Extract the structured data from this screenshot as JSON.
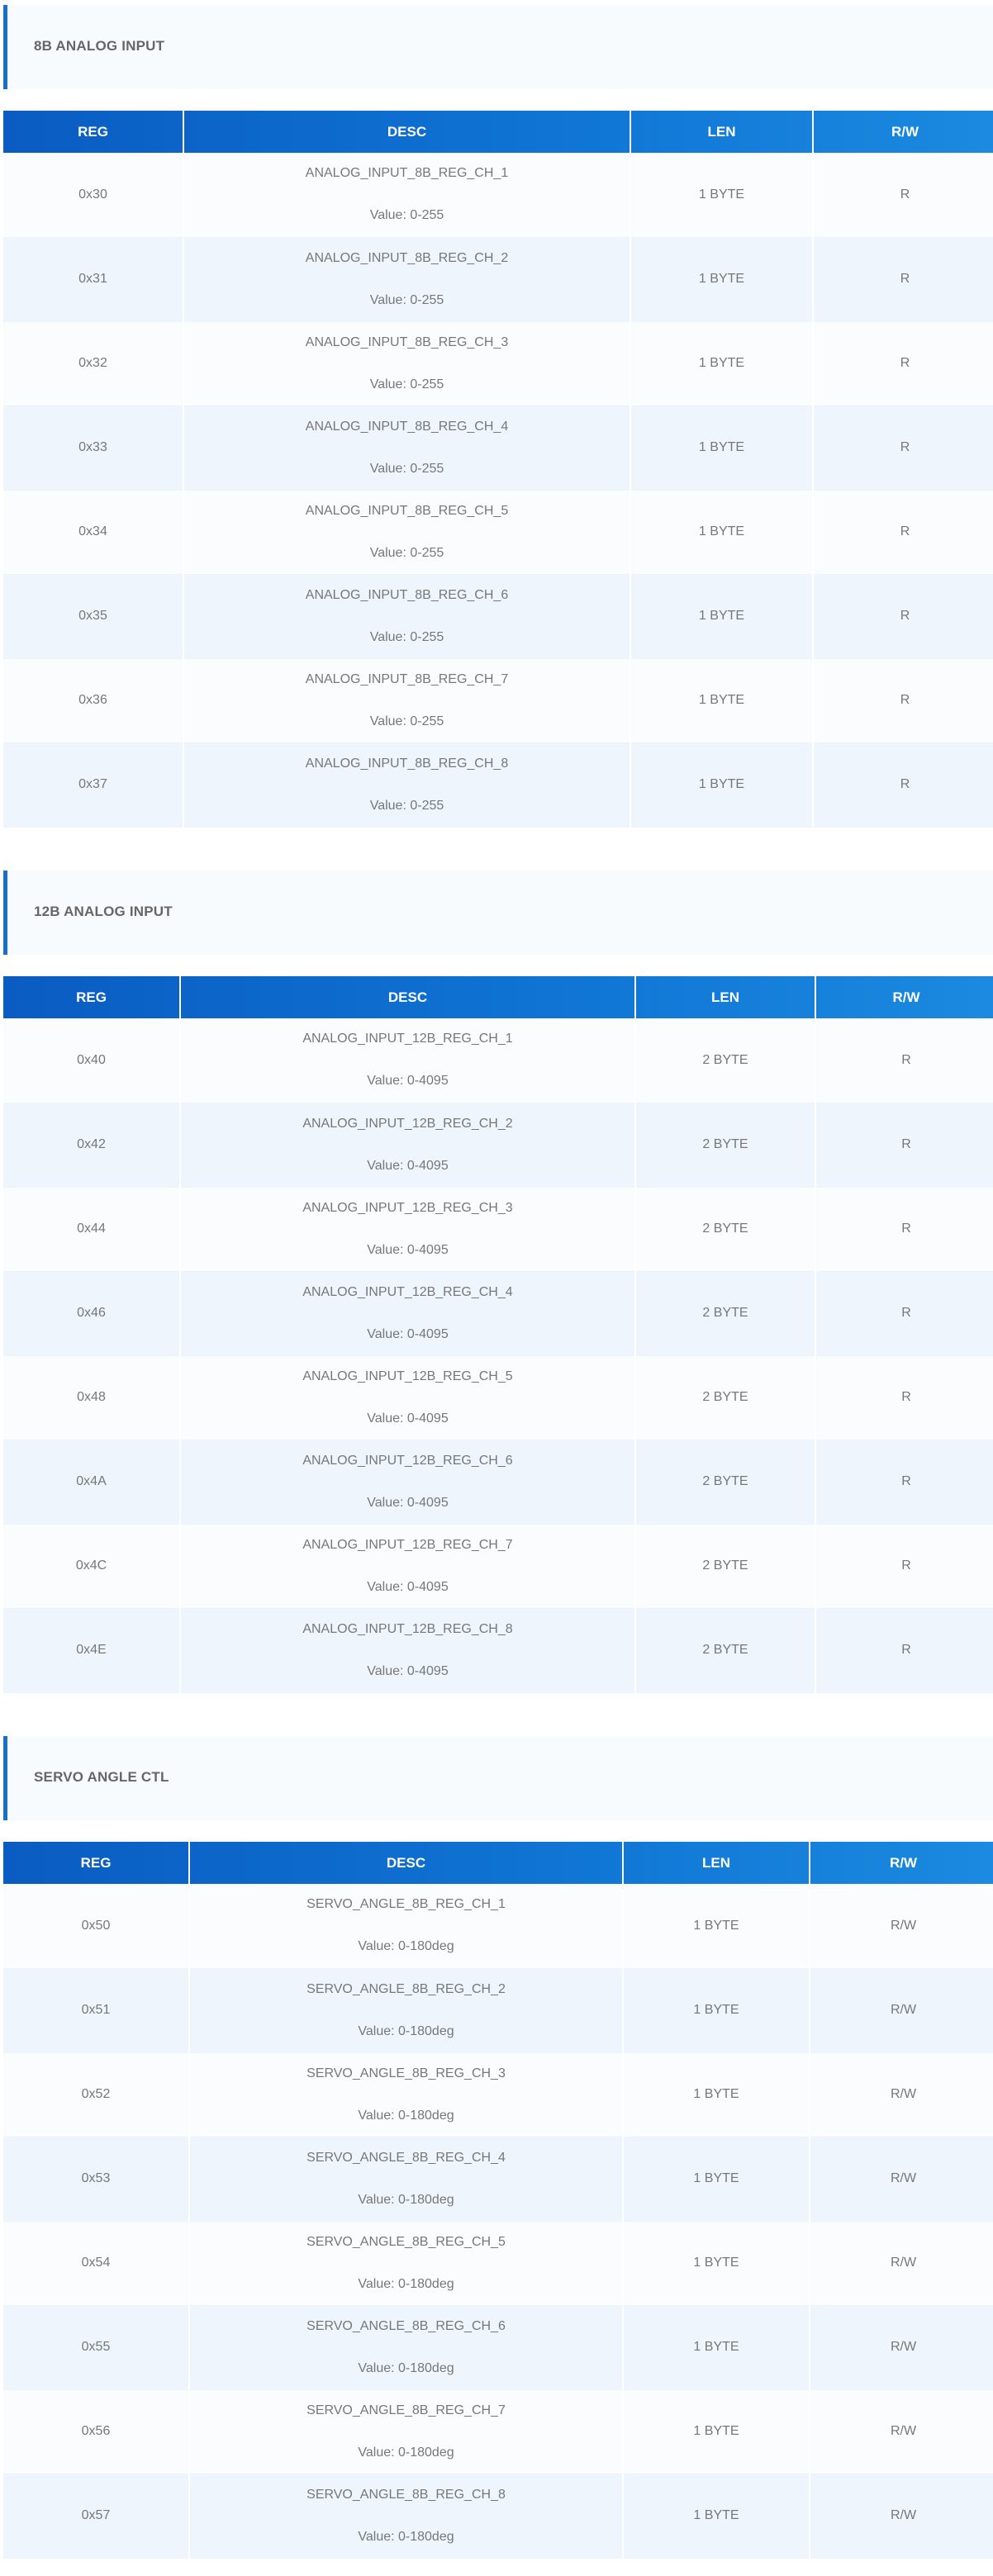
{
  "sections": [
    {
      "title": "8B ANALOG INPUT",
      "headers": {
        "reg": "REG",
        "desc": "DESC",
        "len": "LEN",
        "rw": "R/W"
      },
      "rows": [
        {
          "reg": "0x30",
          "name": "ANALOG_INPUT_8B_REG_CH_1",
          "value": "Value: 0-255",
          "len": "1 BYTE",
          "rw": "R"
        },
        {
          "reg": "0x31",
          "name": "ANALOG_INPUT_8B_REG_CH_2",
          "value": "Value: 0-255",
          "len": "1 BYTE",
          "rw": "R"
        },
        {
          "reg": "0x32",
          "name": "ANALOG_INPUT_8B_REG_CH_3",
          "value": "Value: 0-255",
          "len": "1 BYTE",
          "rw": "R"
        },
        {
          "reg": "0x33",
          "name": "ANALOG_INPUT_8B_REG_CH_4",
          "value": "Value: 0-255",
          "len": "1 BYTE",
          "rw": "R"
        },
        {
          "reg": "0x34",
          "name": "ANALOG_INPUT_8B_REG_CH_5",
          "value": "Value: 0-255",
          "len": "1 BYTE",
          "rw": "R"
        },
        {
          "reg": "0x35",
          "name": "ANALOG_INPUT_8B_REG_CH_6",
          "value": "Value: 0-255",
          "len": "1 BYTE",
          "rw": "R"
        },
        {
          "reg": "0x36",
          "name": "ANALOG_INPUT_8B_REG_CH_7",
          "value": "Value: 0-255",
          "len": "1 BYTE",
          "rw": "R"
        },
        {
          "reg": "0x37",
          "name": "ANALOG_INPUT_8B_REG_CH_8",
          "value": "Value: 0-255",
          "len": "1 BYTE",
          "rw": "R"
        }
      ]
    },
    {
      "title": "12B ANALOG INPUT",
      "headers": {
        "reg": "REG",
        "desc": "DESC",
        "len": "LEN",
        "rw": "R/W"
      },
      "rows": [
        {
          "reg": "0x40",
          "name": "ANALOG_INPUT_12B_REG_CH_1",
          "value": "Value: 0-4095",
          "len": "2 BYTE",
          "rw": "R"
        },
        {
          "reg": "0x42",
          "name": "ANALOG_INPUT_12B_REG_CH_2",
          "value": "Value: 0-4095",
          "len": "2 BYTE",
          "rw": "R"
        },
        {
          "reg": "0x44",
          "name": "ANALOG_INPUT_12B_REG_CH_3",
          "value": "Value: 0-4095",
          "len": "2 BYTE",
          "rw": "R"
        },
        {
          "reg": "0x46",
          "name": "ANALOG_INPUT_12B_REG_CH_4",
          "value": "Value: 0-4095",
          "len": "2 BYTE",
          "rw": "R"
        },
        {
          "reg": "0x48",
          "name": "ANALOG_INPUT_12B_REG_CH_5",
          "value": "Value: 0-4095",
          "len": "2 BYTE",
          "rw": "R"
        },
        {
          "reg": "0x4A",
          "name": "ANALOG_INPUT_12B_REG_CH_6",
          "value": "Value: 0-4095",
          "len": "2 BYTE",
          "rw": "R"
        },
        {
          "reg": "0x4C",
          "name": "ANALOG_INPUT_12B_REG_CH_7",
          "value": "Value: 0-4095",
          "len": "2 BYTE",
          "rw": "R"
        },
        {
          "reg": "0x4E",
          "name": "ANALOG_INPUT_12B_REG_CH_8",
          "value": "Value: 0-4095",
          "len": "2 BYTE",
          "rw": "R"
        }
      ]
    },
    {
      "title": "SERVO ANGLE CTL",
      "headers": {
        "reg": "REG",
        "desc": "DESC",
        "len": "LEN",
        "rw": "R/W"
      },
      "rows": [
        {
          "reg": "0x50",
          "name": "SERVO_ANGLE_8B_REG_CH_1",
          "value": "Value: 0-180deg",
          "len": "1 BYTE",
          "rw": "R/W"
        },
        {
          "reg": "0x51",
          "name": "SERVO_ANGLE_8B_REG_CH_2",
          "value": "Value: 0-180deg",
          "len": "1 BYTE",
          "rw": "R/W"
        },
        {
          "reg": "0x52",
          "name": "SERVO_ANGLE_8B_REG_CH_3",
          "value": "Value: 0-180deg",
          "len": "1 BYTE",
          "rw": "R/W"
        },
        {
          "reg": "0x53",
          "name": "SERVO_ANGLE_8B_REG_CH_4",
          "value": "Value: 0-180deg",
          "len": "1 BYTE",
          "rw": "R/W"
        },
        {
          "reg": "0x54",
          "name": "SERVO_ANGLE_8B_REG_CH_5",
          "value": "Value: 0-180deg",
          "len": "1 BYTE",
          "rw": "R/W"
        },
        {
          "reg": "0x55",
          "name": "SERVO_ANGLE_8B_REG_CH_6",
          "value": "Value: 0-180deg",
          "len": "1 BYTE",
          "rw": "R/W"
        },
        {
          "reg": "0x56",
          "name": "SERVO_ANGLE_8B_REG_CH_7",
          "value": "Value: 0-180deg",
          "len": "1 BYTE",
          "rw": "R/W"
        },
        {
          "reg": "0x57",
          "name": "SERVO_ANGLE_8B_REG_CH_8",
          "value": "Value: 0-180deg",
          "len": "1 BYTE",
          "rw": "R/W"
        }
      ]
    }
  ]
}
